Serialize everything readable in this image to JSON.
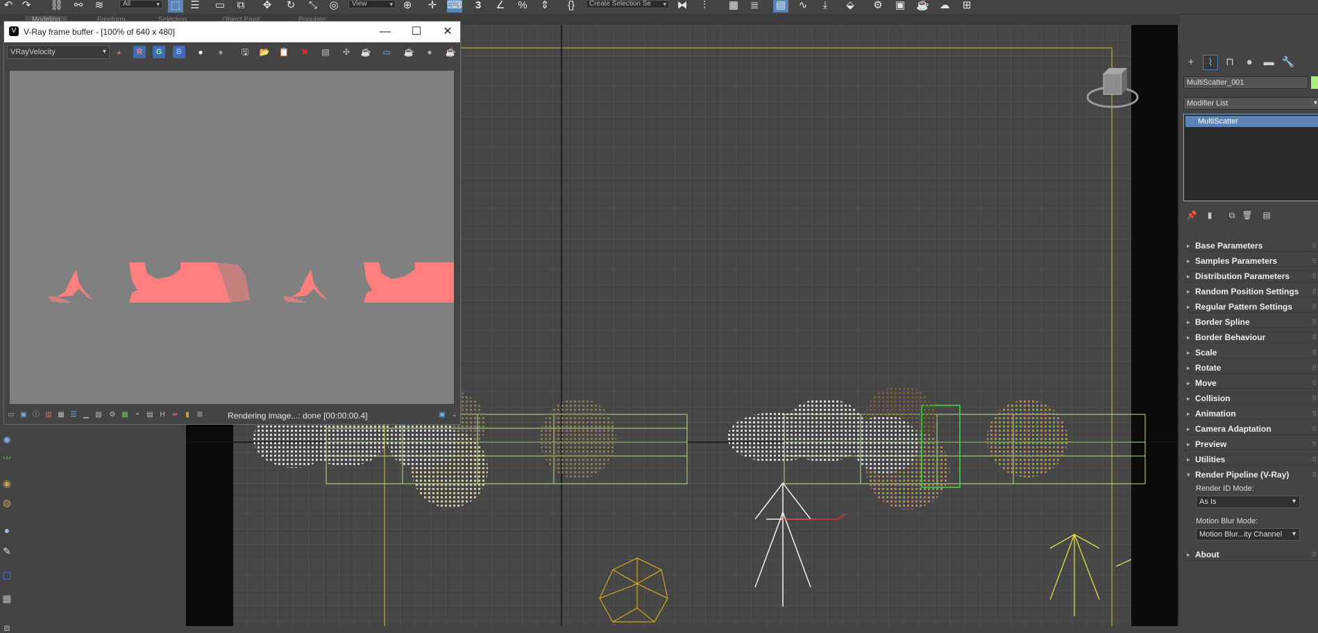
{
  "toolbar": {
    "selection_filter": "All",
    "ref_coord": "View",
    "named_selection": "Create Selection Se",
    "snap_value": "3"
  },
  "ribbon_tabs": [
    "Modeling",
    "Freeform",
    "Selection",
    "Object Paint",
    "Populate"
  ],
  "vfb": {
    "title": "V-Ray frame buffer - [100% of 640 x 480]",
    "channel": "VRayVelocity",
    "btn_r": "R",
    "btn_g": "G",
    "btn_b": "B",
    "status": "Rendering image...: done [00:00:00.4]"
  },
  "command_panel": {
    "object_name": "MultiScatter_001",
    "modifier_list": "Modifier List",
    "stack_item": "MultiScatter",
    "rollouts": [
      "Base Parameters",
      "Samples Parameters",
      "Distribution Parameters",
      "Random Position Settings",
      "Regular Pattern Settings",
      "Border Spline",
      "Border Behaviour",
      "Scale",
      "Rotate",
      "Move",
      "Collision",
      "Animation",
      "Camera Adaptation",
      "Preview",
      "Utilities",
      "Render Pipeline (V-Ray)",
      "About"
    ],
    "render_pipeline": {
      "render_id_label": "Render ID Mode:",
      "render_id_value": "As Is",
      "motion_blur_label": "Motion Blur Mode:",
      "motion_blur_value": "Motion Blur...ity Channel"
    }
  },
  "colors": {
    "accent": "#5b85b8",
    "velocity_red": "#ff7f7f",
    "vfb_bg": "#808080",
    "panel": "#444444"
  }
}
